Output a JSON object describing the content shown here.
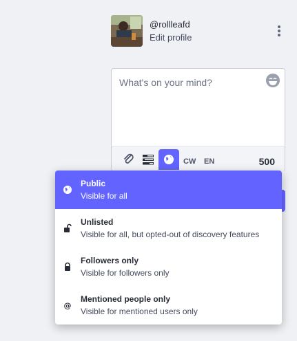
{
  "profile": {
    "handle": "@rollleafd",
    "edit_label": "Edit profile",
    "avatar_icon": "profile-photo",
    "menu_icon": "more-vertical-icon"
  },
  "composer": {
    "placeholder": "What's on your mind?",
    "emoji_icon": "emoji-icon",
    "toolbar": {
      "attach_icon": "paperclip-icon",
      "poll_icon": "poll-icon",
      "privacy_icon": "globe-icon",
      "cw_label": "CW",
      "lang_label": "EN",
      "char_count": "500"
    }
  },
  "privacy_menu": {
    "selected": "public",
    "accent_color": "#6364ff",
    "options": [
      {
        "id": "public",
        "icon": "globe-icon",
        "title": "Public",
        "description": "Visible for all"
      },
      {
        "id": "unlisted",
        "icon": "unlock-icon",
        "title": "Unlisted",
        "description": "Visible for all, but opted-out of discovery features"
      },
      {
        "id": "private",
        "icon": "lock-icon",
        "title": "Followers only",
        "description": "Visible for followers only"
      },
      {
        "id": "direct",
        "icon": "at-icon",
        "title": "Mentioned people only",
        "description": "Visible for mentioned users only"
      }
    ]
  }
}
